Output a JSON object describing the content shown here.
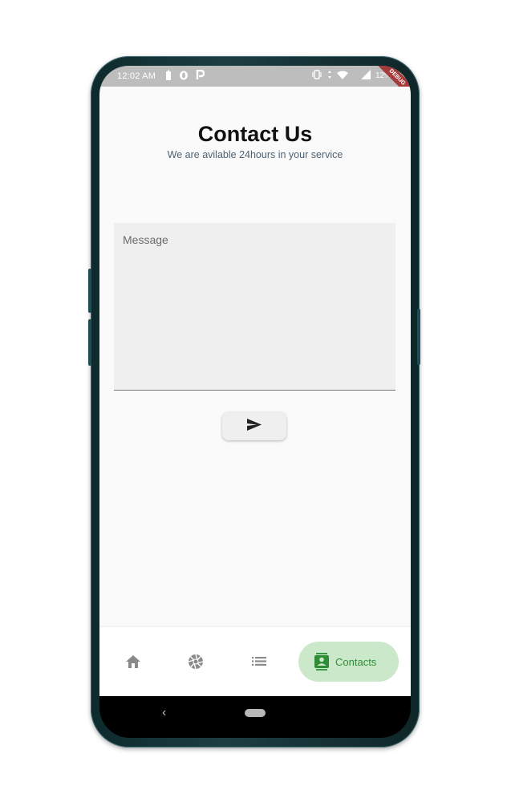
{
  "status_bar": {
    "time": "12:02 AM",
    "battery": "12%",
    "debug_banner": "DEBUG",
    "icons_left": [
      "battery-saver-icon",
      "opera-icon",
      "p-icon"
    ],
    "icons_right": [
      "vibrate-icon",
      "data-arrows-icon",
      "wifi-icon",
      "signal-icon",
      "battery-icon"
    ]
  },
  "header": {
    "title": "Contact Us",
    "subtitle": "We are avilable 24hours in your service"
  },
  "form": {
    "message_placeholder": "Message",
    "message_value": "",
    "send_icon": "send-icon"
  },
  "bottom_nav": {
    "items": [
      {
        "icon": "home-icon",
        "label": ""
      },
      {
        "icon": "camera-aperture-icon",
        "label": ""
      },
      {
        "icon": "list-icon",
        "label": ""
      },
      {
        "icon": "contacts-icon",
        "label": "Contacts",
        "active": true
      }
    ]
  },
  "system_nav": {
    "back": "‹"
  },
  "colors": {
    "active_nav_bg": "#cbe8cb",
    "active_nav_fg": "#2f8e35",
    "status_bar_bg": "#bdbdbd",
    "subtitle": "#4d6273"
  }
}
